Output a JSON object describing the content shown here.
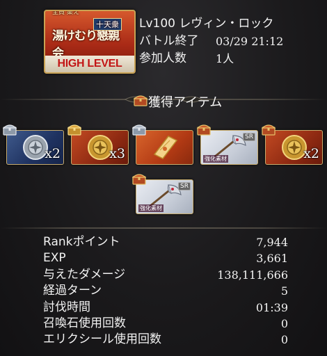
{
  "event": {
    "sub_label": "全員\n集え",
    "tag": "十天衆",
    "title": "湯けむり懇親会",
    "level_label": "HIGH LEVEL"
  },
  "battle_info": {
    "quest_name": "Lv100 レヴィン・ロック",
    "end_label": "バトル終了",
    "end_time": "03/29 21:12",
    "participants_label": "参加人数",
    "participants_value": "1人"
  },
  "rewards": {
    "header": "獲得アイテム",
    "items": [
      {
        "name": "silver-medal",
        "quantity": "x2",
        "chest": "silver"
      },
      {
        "name": "gold-medal",
        "quantity": "x3",
        "chest": "gold"
      },
      {
        "name": "gold-scroll",
        "quantity": "",
        "chest": "silver"
      },
      {
        "name": "axe-weapon",
        "quantity": "",
        "chest": "red",
        "tag": "強化素材",
        "rarity": "SR"
      },
      {
        "name": "gold-medal",
        "quantity": "x2",
        "chest": "red"
      },
      {
        "name": "axe-weapon",
        "quantity": "",
        "chest": "red",
        "tag": "強化素材",
        "rarity": "SR"
      }
    ]
  },
  "results": [
    {
      "label": "Rankポイント",
      "value": "7,944"
    },
    {
      "label": "EXP",
      "value": "3,661"
    },
    {
      "label": "与えたダメージ",
      "value": "138,111,666"
    },
    {
      "label": "経過ターン",
      "value": "5"
    },
    {
      "label": "討伐時間",
      "value": "01:39"
    },
    {
      "label": "召喚石使用回数",
      "value": "0"
    },
    {
      "label": "エリクシール使用回数",
      "value": "0"
    }
  ],
  "colors": {
    "chest_silver": "#b9c3cf",
    "chest_gold": "#d8a640",
    "chest_red": "#c0572b",
    "accent_gold": "#c9ad6e"
  }
}
